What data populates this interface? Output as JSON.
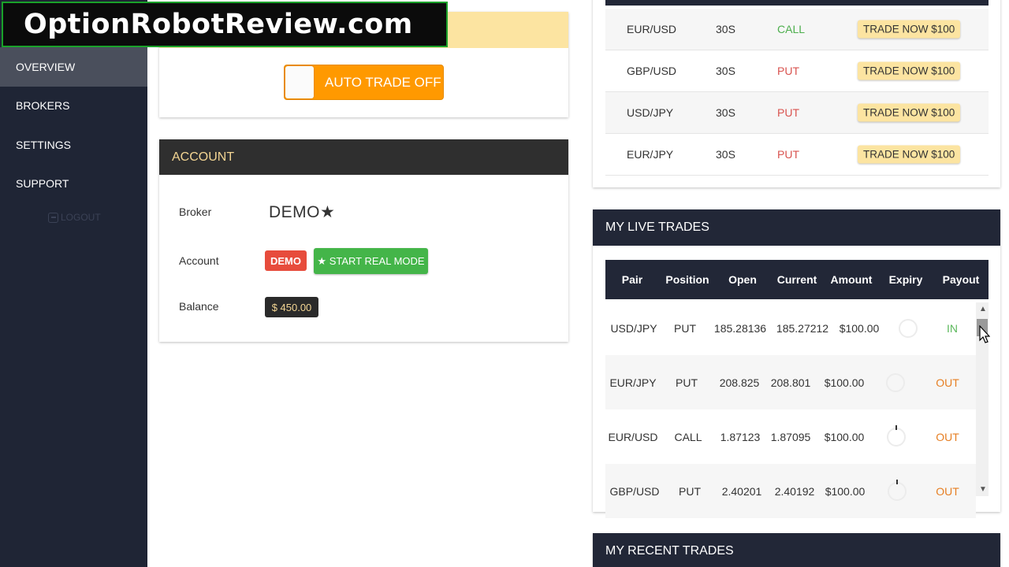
{
  "watermark": "OptionRobotReview.com",
  "sidebar": {
    "items": [
      {
        "label": "OVERVIEW"
      },
      {
        "label": "BROKERS"
      },
      {
        "label": "SETTINGS"
      },
      {
        "label": "SUPPORT"
      }
    ],
    "logout": "LOGOUT"
  },
  "autotrade": {
    "label": "AUTO TRADE OFF"
  },
  "account": {
    "title": "ACCOUNT",
    "broker_label": "Broker",
    "broker_value": "DEMO★",
    "account_label": "Account",
    "account_badge": "DEMO",
    "start_real": "★ START REAL MODE",
    "balance_label": "Balance",
    "balance_value": "$ 450.00"
  },
  "signals": [
    {
      "pair": "EUR/USD",
      "expiry": "30S",
      "direction": "CALL",
      "action": "TRADE NOW $100"
    },
    {
      "pair": "GBP/USD",
      "expiry": "30S",
      "direction": "PUT",
      "action": "TRADE NOW $100"
    },
    {
      "pair": "USD/JPY",
      "expiry": "30S",
      "direction": "PUT",
      "action": "TRADE NOW $100"
    },
    {
      "pair": "EUR/JPY",
      "expiry": "30S",
      "direction": "PUT",
      "action": "TRADE NOW $100"
    }
  ],
  "live_trades": {
    "title": "MY LIVE TRADES",
    "columns": [
      "Pair",
      "Position",
      "Open",
      "Current",
      "Amount",
      "Expiry",
      "Payout"
    ],
    "rows": [
      {
        "pair": "USD/JPY",
        "position": "PUT",
        "open": "185.28136",
        "current": "185.27212",
        "amount": "$100.00",
        "payout": "IN"
      },
      {
        "pair": "EUR/JPY",
        "position": "PUT",
        "open": "208.825",
        "current": "208.801",
        "amount": "$100.00",
        "payout": "OUT"
      },
      {
        "pair": "EUR/USD",
        "position": "CALL",
        "open": "1.87123",
        "current": "1.87095",
        "amount": "$100.00",
        "payout": "OUT"
      },
      {
        "pair": "GBP/USD",
        "position": "PUT",
        "open": "2.40201",
        "current": "2.40192",
        "amount": "$100.00",
        "payout": "OUT"
      }
    ]
  },
  "recent_trades": {
    "title": "MY RECENT TRADES"
  },
  "colors": {
    "sidebar_bg": "#1f2535",
    "accent_orange": "#ff9900",
    "call_green": "#4cae4c",
    "put_red": "#d9534f",
    "header_dark": "#222737"
  }
}
